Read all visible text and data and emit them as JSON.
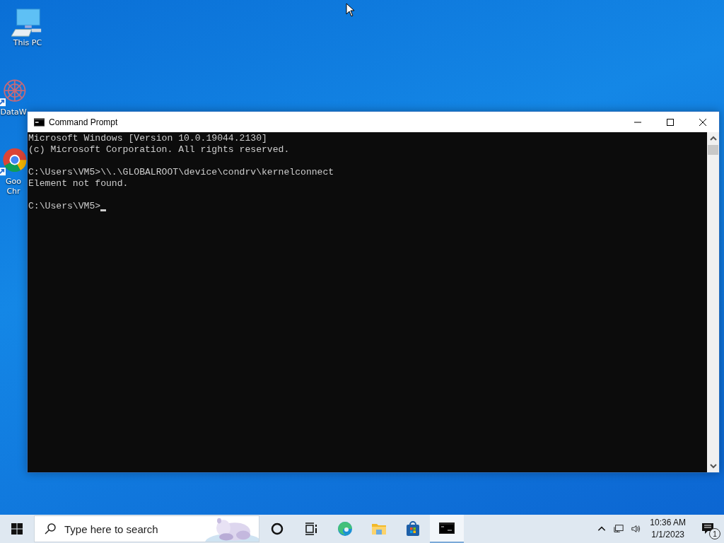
{
  "desktop_icons": [
    {
      "kind": "pc",
      "lines": [
        "This PC"
      ]
    },
    {
      "kind": "molecule",
      "lines": [
        "DataW"
      ]
    },
    {
      "kind": "chrome",
      "lines": [
        "Goo",
        "Chr"
      ]
    }
  ],
  "window": {
    "title": "Command Prompt",
    "blocks": [
      [
        "Microsoft Windows [Version 10.0.19044.2130]",
        "(c) Microsoft Corporation. All rights reserved."
      ],
      [
        "C:\\Users\\VM5>\\\\.\\GLOBALROOT\\device\\condrv\\kernelconnect",
        "Element not found."
      ],
      [
        "C:\\Users\\VM5>"
      ]
    ],
    "cursor": true
  },
  "taskbar": {
    "search": {
      "placeholder": "Type here to search"
    },
    "apps": [
      {
        "kind": "cortana",
        "selected": false
      },
      {
        "kind": "taskview",
        "selected": false
      },
      {
        "kind": "edge",
        "selected": false
      },
      {
        "kind": "explorer",
        "selected": false
      },
      {
        "kind": "store",
        "selected": false
      },
      {
        "kind": "cmd",
        "selected": true
      }
    ],
    "time": "10:36 AM",
    "date": "1/1/2023",
    "notifications": "1"
  }
}
